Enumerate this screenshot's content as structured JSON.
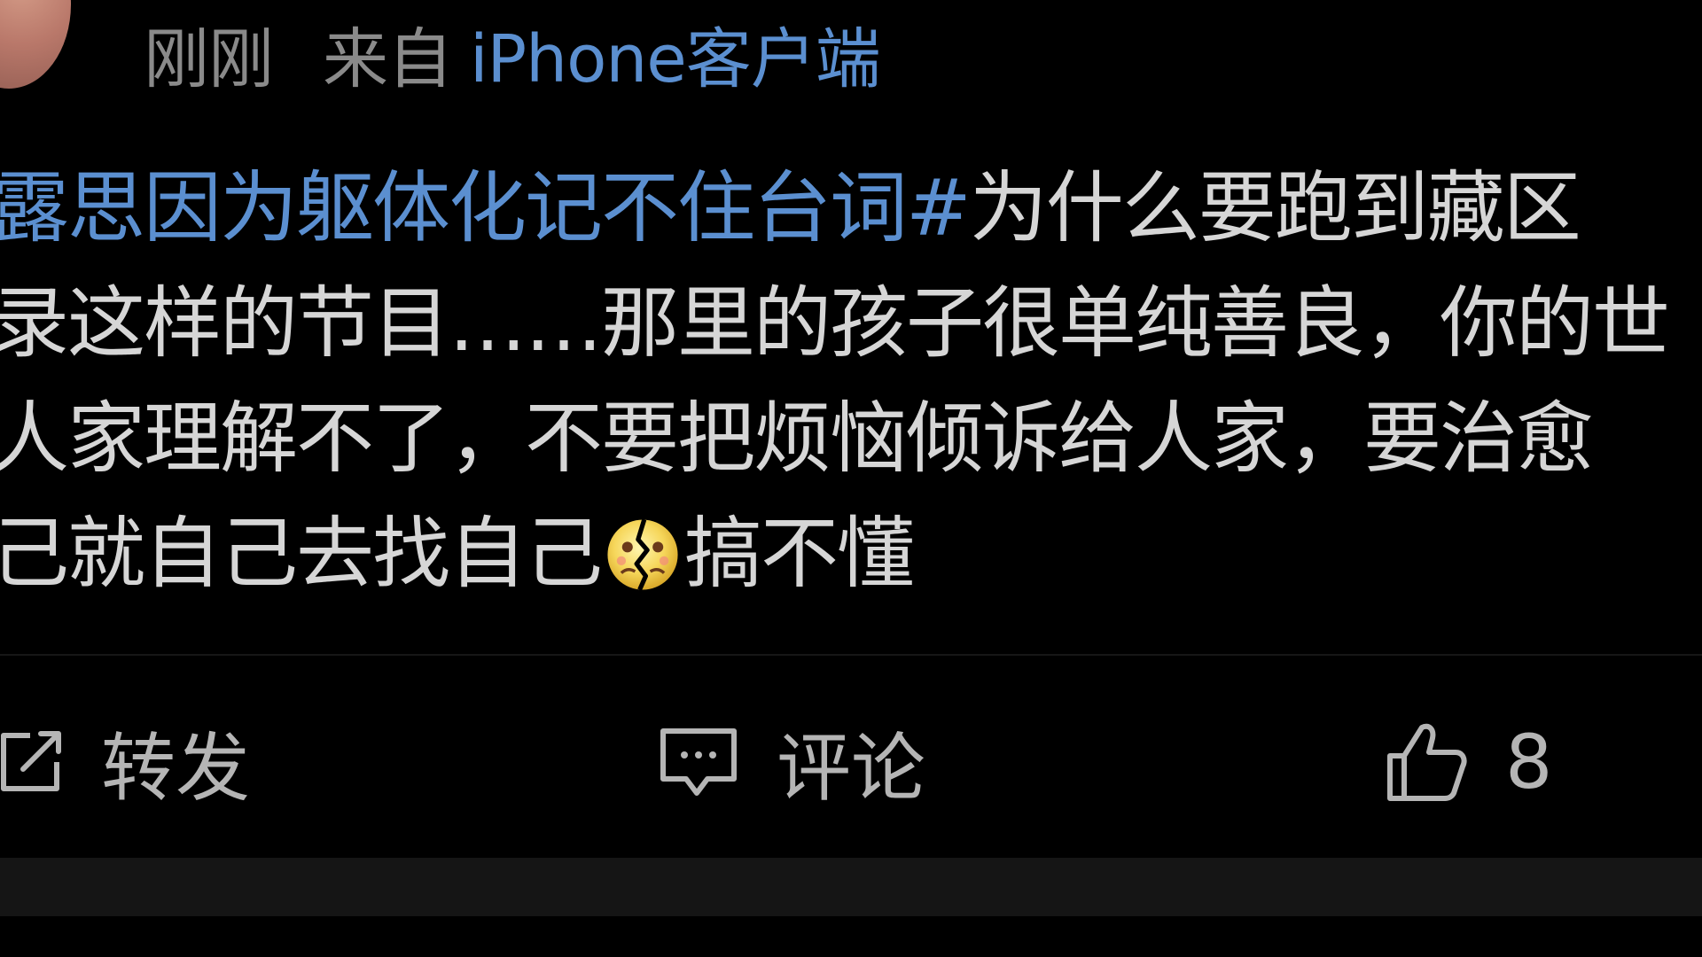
{
  "header": {
    "time": "刚刚",
    "from_prefix": "来自",
    "client": "iPhone客户端"
  },
  "post": {
    "line1_topic": "露思因为躯体化记不住台词#",
    "line1_text": "为什么要跑到藏区",
    "line2": "录这样的节目……那里的孩子很单纯善良，你的世",
    "line3": "人家理解不了，不要把烦恼倾诉给人家，要治愈",
    "line4_before_emoji": "己就自己去找自己",
    "emoji": "broken-heart-face-emoji",
    "line4_after_emoji": "搞不懂"
  },
  "actions": {
    "repost_label": "转发",
    "comment_label": "评论",
    "like_count": "8"
  },
  "colors": {
    "background": "#000000",
    "text": "#d6d6d6",
    "muted": "#8a8a8a",
    "link": "#5b8fd0",
    "icon": "#b5b5b5"
  }
}
